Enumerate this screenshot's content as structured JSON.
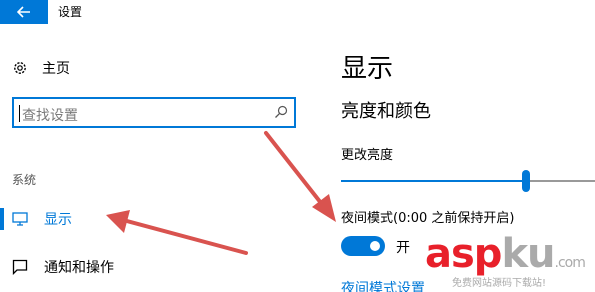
{
  "titlebar": {
    "back_icon": "back-arrow-icon",
    "title": "设置"
  },
  "sidebar": {
    "home_label": "主页",
    "home_icon": "gear-icon",
    "search": {
      "placeholder": "查找设置",
      "icon": "search-icon"
    },
    "section_label": "系统",
    "items": [
      {
        "label": "显示",
        "icon": "monitor-icon",
        "active": true
      },
      {
        "label": "通知和操作",
        "icon": "notification-icon",
        "active": false
      }
    ]
  },
  "main": {
    "title": "显示",
    "section_title": "亮度和颜色",
    "brightness_label": "更改亮度",
    "brightness_level": 0.73,
    "night_mode_label": "夜间模式(0:00 之前保持开启)",
    "night_mode_toggle": {
      "state": "on",
      "label": "开"
    },
    "night_mode_link": "夜间模式设置"
  },
  "watermark": {
    "logo_parts": [
      {
        "text": "asp",
        "color": "#e8202a"
      },
      {
        "text": "ku",
        "color": "#aaaaaa"
      },
      {
        "text": ".com",
        "color": "#aaaaaa"
      }
    ],
    "subtitle": "免费网站源码下载站!"
  },
  "colors": {
    "accent": "#0078d7",
    "annotation_arrow": "#d9534f"
  }
}
